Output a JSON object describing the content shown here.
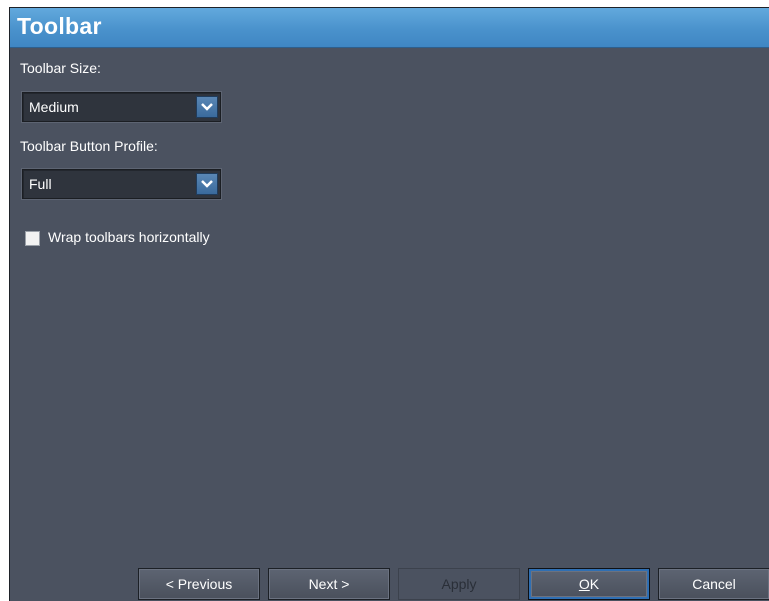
{
  "dialog": {
    "title": "Toolbar"
  },
  "fields": {
    "toolbar_size": {
      "label": "Toolbar Size:",
      "value": "Medium"
    },
    "button_profile": {
      "label": "Toolbar Button Profile:",
      "value": "Full"
    },
    "wrap": {
      "label": "Wrap toolbars horizontally",
      "checked": false
    }
  },
  "buttons": {
    "previous": "< Previous",
    "next": "Next >",
    "apply": "Apply",
    "ok_mnemonic": "O",
    "ok_rest": "K",
    "cancel": "Cancel"
  },
  "icons": {
    "dropdown": "chevron-down-icon"
  },
  "colors": {
    "panel_bg": "#4b5260",
    "title_bar": "#4a92cc",
    "field_bg": "#2f343d",
    "text": "#ffffff"
  }
}
